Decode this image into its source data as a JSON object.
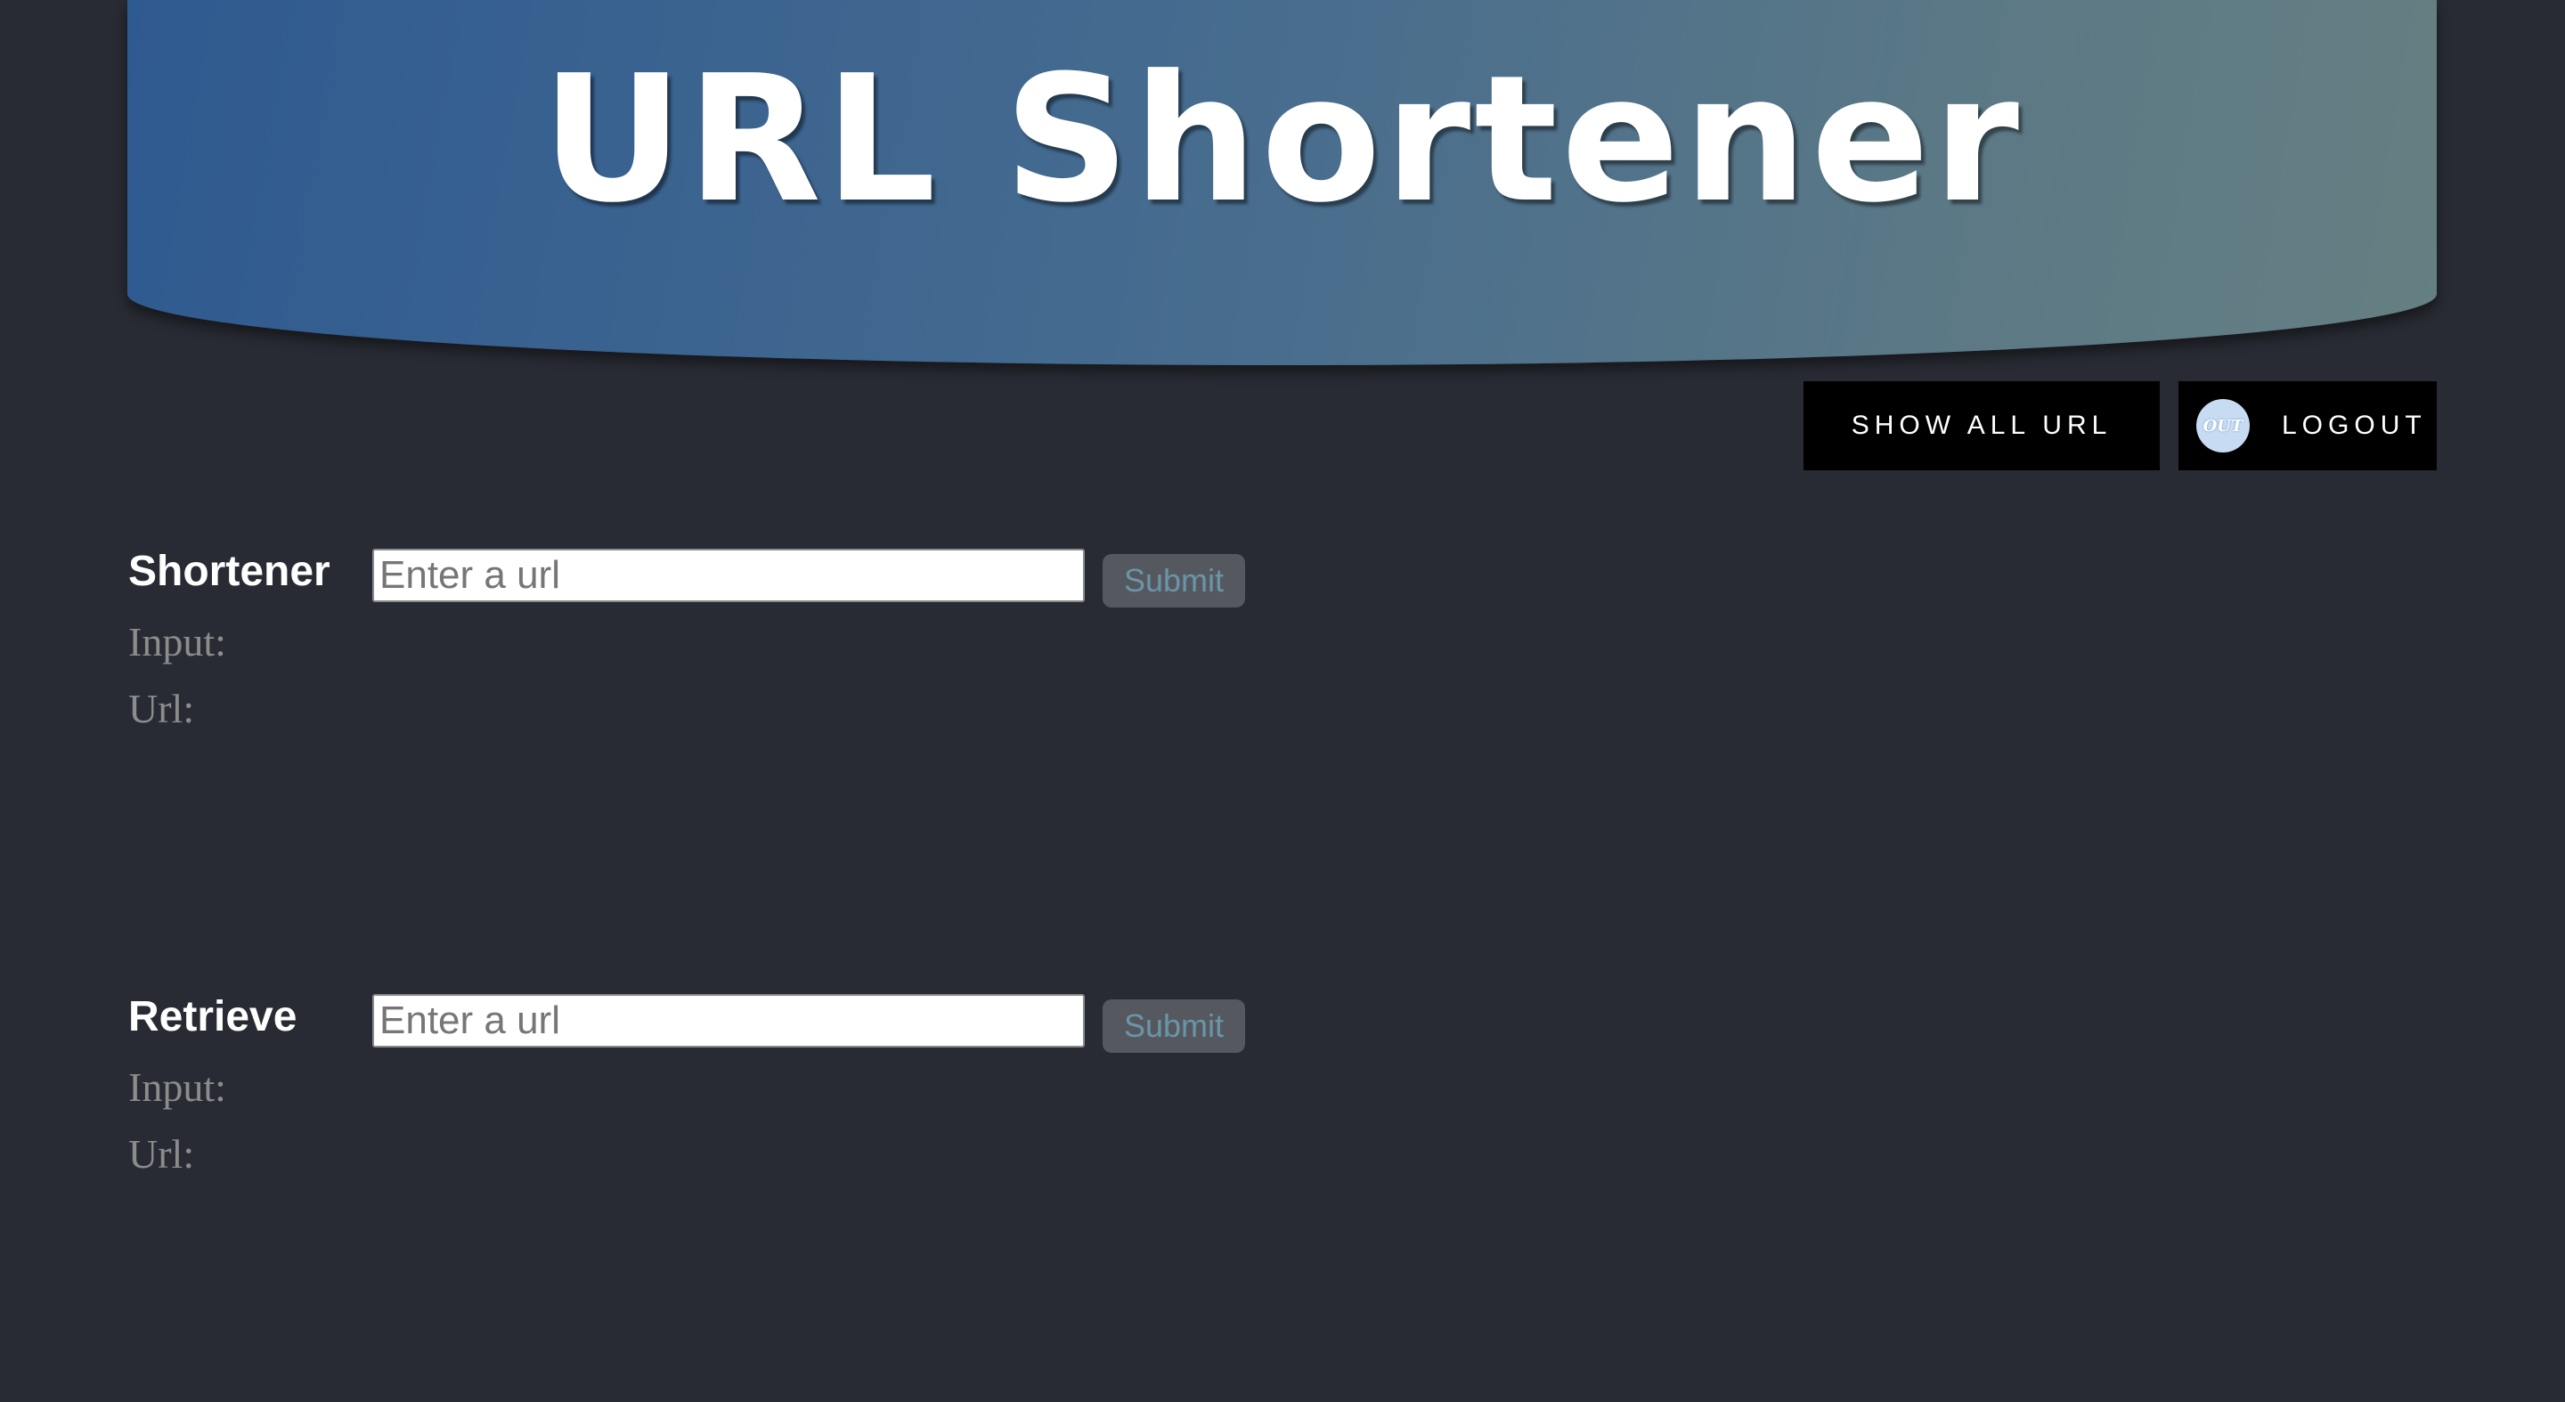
{
  "header": {
    "title": "URL Shortener"
  },
  "toolbar": {
    "show_all_label": "SHOW ALL URL",
    "logout_badge": "OUT",
    "logout_label": "LOGOUT"
  },
  "shortener": {
    "title": "Shortener",
    "placeholder": "Enter a url",
    "submit_label": "Submit",
    "input_label": "Input:",
    "url_label": "Url:"
  },
  "retrieve": {
    "title": "Retrieve",
    "placeholder": "Enter a url",
    "submit_label": "Submit",
    "input_label": "Input:",
    "url_label": "Url:"
  },
  "colors": {
    "background": "#282b33",
    "banner_start": "#2f5a90",
    "banner_end": "#657f82",
    "button_dark": "#000000",
    "submit_bg": "#55595f",
    "submit_text": "#6a95a8",
    "label_gray": "#8c8c8c"
  }
}
